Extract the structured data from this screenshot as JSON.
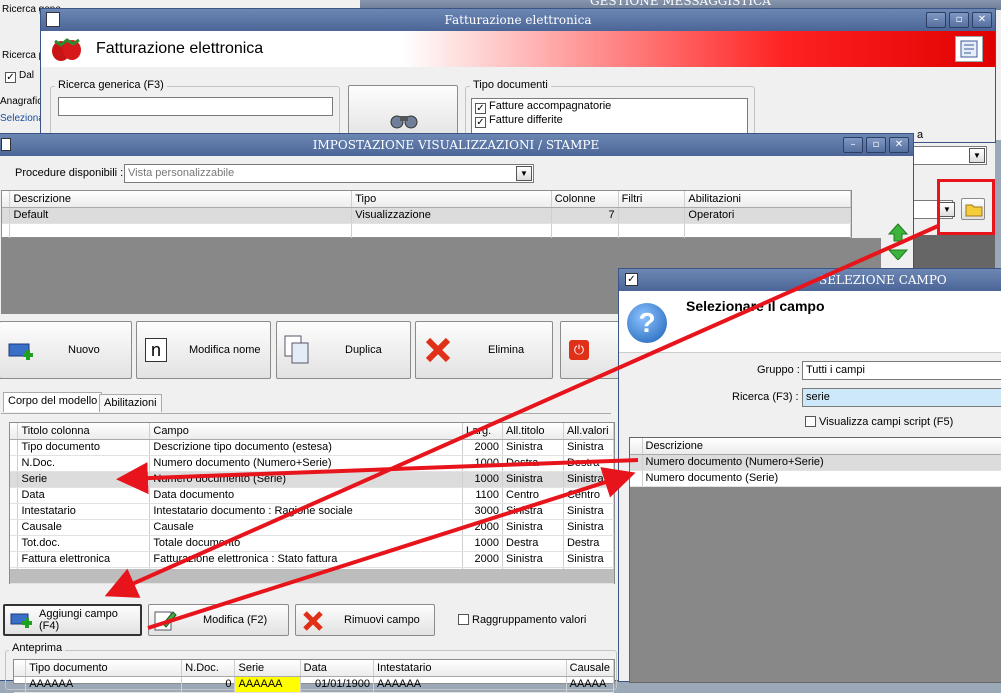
{
  "background_window": {
    "title": "GESTIONE MESSAGGISTICA",
    "left_items": [
      "Ricerca gene",
      "Ricerca pe",
      "Dal",
      "Anagrafica",
      "Seleziona"
    ]
  },
  "fatt_window": {
    "title": "Fatturazione elettronica",
    "header_title": "Fatturazione elettronica",
    "search_label": "Ricerca generica (F3)",
    "search_value": "",
    "tipo_label": "Tipo documenti",
    "tipo_options": [
      {
        "label": "Fatture accompagnatorie",
        "checked": true
      },
      {
        "label": "Fatture differite",
        "checked": true
      }
    ],
    "partial_label": "a"
  },
  "imp_window": {
    "title": "IMPOSTAZIONE VISUALIZZAZIONI / STAMPE",
    "procedure_label": "Procedure disponibili :",
    "procedure_value": "Vista personalizzabile",
    "models_columns": [
      "Descrizione",
      "Tipo",
      "Colonne",
      "Filtri",
      "Abilitazioni"
    ],
    "models_rows": [
      {
        "descrizione": "Default",
        "tipo": "Visualizzazione",
        "colonne": "7",
        "filtri": "",
        "abilitazioni": "Operatori"
      }
    ],
    "buttons": {
      "nuovo": "Nuovo",
      "modifica_nome": "Modifica nome",
      "duplica": "Duplica",
      "elimina": "Elimina"
    },
    "tabs": [
      "Corpo del modello",
      "Abilitazioni"
    ],
    "fields_columns": [
      "Titolo colonna",
      "Campo",
      "Larg.",
      "All.titolo",
      "All.valori"
    ],
    "fields_rows": [
      {
        "titolo": "Tipo documento",
        "campo": "Descrizione tipo documento (estesa)",
        "larg": "2000",
        "all_titolo": "Sinistra",
        "all_valori": "Sinistra"
      },
      {
        "titolo": "N.Doc.",
        "campo": "Numero documento (Numero+Serie)",
        "larg": "1000",
        "all_titolo": "Destra",
        "all_valori": "Destra"
      },
      {
        "titolo": "Serie",
        "campo": "Numero documento (Serie)",
        "larg": "1000",
        "all_titolo": "Sinistra",
        "all_valori": "Sinistra"
      },
      {
        "titolo": "Data",
        "campo": "Data documento",
        "larg": "1100",
        "all_titolo": "Centro",
        "all_valori": "Centro"
      },
      {
        "titolo": "Intestatario",
        "campo": "Intestatario documento : Ragione sociale",
        "larg": "3000",
        "all_titolo": "Sinistra",
        "all_valori": "Sinistra"
      },
      {
        "titolo": "Causale",
        "campo": "Causale",
        "larg": "2000",
        "all_titolo": "Sinistra",
        "all_valori": "Sinistra"
      },
      {
        "titolo": "Tot.doc.",
        "campo": "Totale documento",
        "larg": "1000",
        "all_titolo": "Destra",
        "all_valori": "Destra"
      },
      {
        "titolo": "Fattura elettronica",
        "campo": "Fatturazione elettronica : Stato fattura",
        "larg": "2000",
        "all_titolo": "Sinistra",
        "all_valori": "Sinistra"
      }
    ],
    "field_buttons": {
      "aggiungi": "Aggiungi campo (F4)",
      "modifica": "Modifica (F2)",
      "rimuovi": "Rimuovi campo"
    },
    "raggruppamento_label": "Raggruppamento valori",
    "anteprima_label": "Anteprima",
    "preview_columns": [
      "Tipo documento",
      "N.Doc.",
      "Serie",
      "Data",
      "Intestatario",
      "Causale"
    ],
    "preview_row": [
      "AAAAAA",
      "0",
      "AAAAAA",
      "01/01/1900",
      "AAAAAA",
      "AAAAA"
    ]
  },
  "sel_window": {
    "title": "SELEZIONE CAMPO",
    "header": "Selezionare il campo",
    "gruppo_label": "Gruppo :",
    "gruppo_value": "Tutti i campi",
    "ricerca_label": "Ricerca (F3) :",
    "ricerca_value": "serie",
    "script_label": "Visualizza campi script (F5)",
    "list_header": "Descrizione",
    "list_items": [
      "Numero documento (Numero+Serie)",
      "Numero documento (Serie)"
    ]
  },
  "colors": {
    "arrow": "#e8141c",
    "highlight_serie": "#ffff00",
    "title_blue": "#5a74a5"
  }
}
